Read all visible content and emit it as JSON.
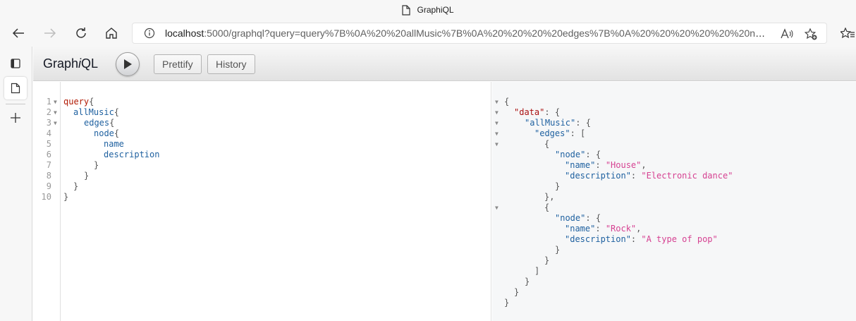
{
  "window": {
    "title": "GraphiQL"
  },
  "address_bar": {
    "host": "localhost",
    "path": ":5000/graphql?query=query%7B%0A%20%20allMusic%7B%0A%20%20%20%20edges%7B%0A%20%20%20%20%20%20node%..."
  },
  "graphiql": {
    "title_pre": "Graph",
    "title_i": "i",
    "title_post": "QL",
    "prettify_label": "Prettify",
    "history_label": "History"
  },
  "query_lines": [
    "1",
    "2",
    "3",
    "4",
    "5",
    "6",
    "7",
    "8",
    "9",
    "10"
  ],
  "query": {
    "l1": "query",
    "l1b": "{",
    "l2": "allMusic",
    "l2b": "{",
    "l3": "edges",
    "l3b": "{",
    "l4": "node",
    "l4b": "{",
    "l5": "name",
    "l6": "description",
    "l7": "}",
    "l8": "}",
    "l9": "}",
    "l10": "}"
  },
  "result": {
    "open": "{",
    "data_key": "\"data\"",
    "allmusic_key": "\"allMusic\"",
    "edges_key": "\"edges\"",
    "node_key": "\"node\"",
    "name_key": "\"name\"",
    "desc_key": "\"description\"",
    "item1_name": "\"House\"",
    "item1_desc": "\"Electronic dance\"",
    "item2_name": "\"Rock\"",
    "item2_desc": "\"A type of pop\"",
    "colon": ": ",
    "comma": ",",
    "brace_open": "{",
    "brace_close": "}",
    "brace_close_comma": "},",
    "bracket_open": "[",
    "bracket_close": "]"
  }
}
